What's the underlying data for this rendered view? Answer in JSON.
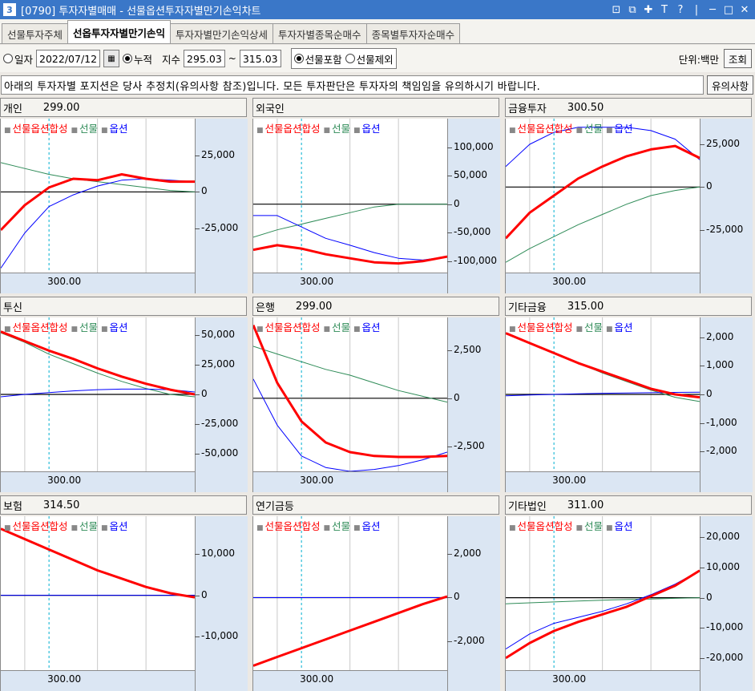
{
  "window": {
    "number": "3",
    "title": "[0790] 투자자별매매 - 선물옵션투자자별만기손익차트",
    "controls": [
      "⊡",
      "⧉",
      "✚",
      "T",
      "?",
      "|",
      "─",
      "□",
      "✕"
    ]
  },
  "tabs": [
    {
      "label": "선물투자주체",
      "active": false
    },
    {
      "label": "선옵투자자별만기손익",
      "active": true
    },
    {
      "label": "투자자별만기손익상세",
      "active": false
    },
    {
      "label": "투자자별종목순매수",
      "active": false
    },
    {
      "label": "종목별투자자순매수",
      "active": false
    }
  ],
  "toolbar": {
    "date_radio": "일자",
    "date_value": "2022/07/12",
    "cum_radio": "누적",
    "index_label": "지수",
    "index_from": "295.03",
    "index_sep": "~",
    "index_to": "315.03",
    "include_radio": "선물포함",
    "exclude_radio": "선물제외",
    "unit": "단위:백만",
    "query_button": "조회"
  },
  "notice": {
    "text": "아래의 투자자별 포지션은 당사 추정치(유의사항 참조)입니다. 모든 투자판단은 투자자의 책임임을 유의하시기 바랍니다.",
    "button": "유의사항"
  },
  "legend": {
    "combined": "선물옵션합성",
    "futures": "선물",
    "options": "옵션"
  },
  "colors": {
    "combined": "#ff0000",
    "futures": "#2e8b57",
    "options": "#0000ff",
    "zero": "#000000",
    "vline": "#00b0d0",
    "axis_bg": "#dbe6f3"
  },
  "xtick": "300.00",
  "panels": [
    {
      "name": "개인",
      "value": "299.00"
    },
    {
      "name": "외국인",
      "value": ""
    },
    {
      "name": "금융투자",
      "value": "300.50"
    },
    {
      "name": "투신",
      "value": ""
    },
    {
      "name": "은행",
      "value": "299.00"
    },
    {
      "name": "기타금융",
      "value": "315.00"
    },
    {
      "name": "보험",
      "value": "314.50"
    },
    {
      "name": "연기금등",
      "value": ""
    },
    {
      "name": "기타법인",
      "value": "311.00"
    }
  ],
  "chart_data": [
    {
      "type": "line",
      "title": "개인",
      "x": [
        295.03,
        297.5,
        300,
        302.5,
        305,
        307.5,
        310,
        312.5,
        315.03
      ],
      "xtick": 300.0,
      "vline": 300.0,
      "yticks": [
        25000,
        0,
        -25000
      ],
      "ylim": [
        -55000,
        50000
      ],
      "series": [
        {
          "name": "선물옵션합성",
          "values": [
            -26000,
            -9000,
            3000,
            9000,
            8000,
            12000,
            9000,
            7000,
            7000
          ]
        },
        {
          "name": "선물",
          "values": [
            20000,
            16000,
            12000,
            9000,
            7000,
            5000,
            3000,
            1000,
            0
          ]
        },
        {
          "name": "옵션",
          "values": [
            -52000,
            -28000,
            -10000,
            -2000,
            4000,
            8000,
            9000,
            8000,
            7000
          ]
        }
      ]
    },
    {
      "type": "line",
      "title": "외국인",
      "x": [
        295.03,
        297.5,
        300,
        302.5,
        305,
        307.5,
        310,
        312.5,
        315.03
      ],
      "xtick": 300.0,
      "vline": 300.0,
      "yticks": [
        100000,
        50000,
        0,
        -50000,
        -100000
      ],
      "ylim": [
        -120000,
        150000
      ],
      "series": [
        {
          "name": "선물옵션합성",
          "values": [
            -80000,
            -72000,
            -78000,
            -88000,
            -95000,
            -102000,
            -104000,
            -100000,
            -92000
          ]
        },
        {
          "name": "선물",
          "values": [
            -58000,
            -45000,
            -35000,
            -25000,
            -15000,
            -5000,
            0,
            0,
            0
          ]
        },
        {
          "name": "옵션",
          "values": [
            -20000,
            -20000,
            -40000,
            -60000,
            -72000,
            -85000,
            -95000,
            -98000,
            -92000
          ]
        }
      ]
    },
    {
      "type": "line",
      "title": "금융투자",
      "x": [
        295.03,
        297.5,
        300,
        302.5,
        305,
        307.5,
        310,
        312.5,
        315.03
      ],
      "xtick": 300.0,
      "vline": 300.0,
      "yticks": [
        25000,
        0,
        -25000
      ],
      "ylim": [
        -50000,
        40000
      ],
      "series": [
        {
          "name": "선물옵션합성",
          "values": [
            -30000,
            -15000,
            -5000,
            5000,
            12000,
            18000,
            22000,
            24000,
            17000
          ]
        },
        {
          "name": "선물",
          "values": [
            -44000,
            -36000,
            -29000,
            -22000,
            -16000,
            -10000,
            -5000,
            -2000,
            0
          ]
        },
        {
          "name": "옵션",
          "values": [
            12000,
            25000,
            32000,
            35000,
            35000,
            35000,
            33000,
            28000,
            16000
          ]
        }
      ]
    },
    {
      "type": "line",
      "title": "투신",
      "x": [
        295.03,
        297.5,
        300,
        302.5,
        305,
        307.5,
        310,
        312.5,
        315.03
      ],
      "xtick": 300.0,
      "vline": 300.0,
      "yticks": [
        50000,
        25000,
        0,
        -25000,
        -50000
      ],
      "ylim": [
        -65000,
        65000
      ],
      "series": [
        {
          "name": "선물옵션합성",
          "values": [
            53000,
            45000,
            37000,
            30000,
            22000,
            15000,
            9000,
            4000,
            0
          ]
        },
        {
          "name": "선물",
          "values": [
            52000,
            44000,
            34000,
            26000,
            18000,
            11000,
            5000,
            0,
            -2000
          ]
        },
        {
          "name": "옵션",
          "values": [
            -2000,
            0,
            1500,
            3000,
            4000,
            4500,
            4500,
            4000,
            2000
          ]
        }
      ]
    },
    {
      "type": "line",
      "title": "은행",
      "x": [
        295.03,
        297.5,
        300,
        302.5,
        305,
        307.5,
        310,
        312.5,
        315.03
      ],
      "xtick": 300.0,
      "vline": 300.0,
      "yticks": [
        2500,
        0,
        -2500
      ],
      "ylim": [
        -3800,
        4200
      ],
      "series": [
        {
          "name": "선물옵션합성",
          "values": [
            3800,
            800,
            -1200,
            -2300,
            -2800,
            -3000,
            -3050,
            -3050,
            -3000
          ]
        },
        {
          "name": "선물",
          "values": [
            2700,
            2300,
            1900,
            1500,
            1200,
            800,
            400,
            100,
            -200
          ]
        },
        {
          "name": "옵션",
          "values": [
            1000,
            -1400,
            -3000,
            -3600,
            -3800,
            -3700,
            -3500,
            -3200,
            -2800
          ]
        }
      ]
    },
    {
      "type": "line",
      "title": "기타금융",
      "x": [
        295.03,
        297.5,
        300,
        302.5,
        305,
        307.5,
        310,
        312.5,
        315.03
      ],
      "xtick": 300.0,
      "vline": 300.0,
      "yticks": [
        2000,
        1000,
        0,
        -1000,
        -2000
      ],
      "ylim": [
        -2700,
        2700
      ],
      "series": [
        {
          "name": "선물옵션합성",
          "values": [
            2150,
            1800,
            1450,
            1100,
            800,
            500,
            200,
            0,
            -100
          ]
        },
        {
          "name": "선물",
          "values": [
            2150,
            1800,
            1450,
            1100,
            750,
            450,
            150,
            -100,
            -250
          ]
        },
        {
          "name": "옵션",
          "values": [
            -50,
            -20,
            0,
            20,
            40,
            50,
            60,
            70,
            80
          ]
        }
      ]
    },
    {
      "type": "line",
      "title": "보험",
      "x": [
        295.03,
        297.5,
        300,
        302.5,
        305,
        307.5,
        310,
        312.5,
        315.03
      ],
      "xtick": 300.0,
      "vline": 300.0,
      "yticks": [
        10000,
        0,
        -10000
      ],
      "ylim": [
        -18000,
        19000
      ],
      "series": [
        {
          "name": "선물옵션합성",
          "values": [
            16000,
            13500,
            11000,
            8500,
            6000,
            4000,
            2000,
            500,
            -500
          ]
        },
        {
          "name": "선물",
          "values": [
            16000,
            13500,
            11000,
            8500,
            6000,
            4000,
            2000,
            500,
            -500
          ]
        },
        {
          "name": "옵션",
          "values": [
            0,
            0,
            0,
            0,
            0,
            0,
            0,
            0,
            0
          ]
        }
      ]
    },
    {
      "type": "line",
      "title": "연기금등",
      "x": [
        295.03,
        297.5,
        300,
        302.5,
        305,
        307.5,
        310,
        312.5,
        315.03
      ],
      "xtick": 300.0,
      "vline": 300.0,
      "yticks": [
        2000,
        0,
        -2000
      ],
      "ylim": [
        -3300,
        3700
      ],
      "series": [
        {
          "name": "선물옵션합성",
          "values": [
            -3100,
            -2700,
            -2300,
            -1900,
            -1500,
            -1100,
            -700,
            -300,
            50
          ]
        },
        {
          "name": "선물",
          "values": [
            -3100,
            -2700,
            -2300,
            -1900,
            -1500,
            -1100,
            -700,
            -300,
            50
          ]
        },
        {
          "name": "옵션",
          "values": [
            0,
            0,
            0,
            0,
            0,
            0,
            0,
            0,
            0
          ]
        }
      ]
    },
    {
      "type": "line",
      "title": "기타법인",
      "x": [
        295.03,
        297.5,
        300,
        302.5,
        305,
        307.5,
        310,
        312.5,
        315.03
      ],
      "xtick": 300.0,
      "vline": 300.0,
      "yticks": [
        20000,
        10000,
        0,
        -10000,
        -20000
      ],
      "ylim": [
        -24000,
        27000
      ],
      "series": [
        {
          "name": "선물옵션합성",
          "values": [
            -20000,
            -15000,
            -11000,
            -8000,
            -5500,
            -3000,
            500,
            4000,
            9000
          ]
        },
        {
          "name": "선물",
          "values": [
            -2000,
            -1700,
            -1400,
            -1100,
            -800,
            -600,
            -400,
            -200,
            0
          ]
        },
        {
          "name": "옵션",
          "values": [
            -17000,
            -12000,
            -8500,
            -6500,
            -4500,
            -2000,
            1000,
            4500,
            9000
          ]
        }
      ]
    }
  ]
}
